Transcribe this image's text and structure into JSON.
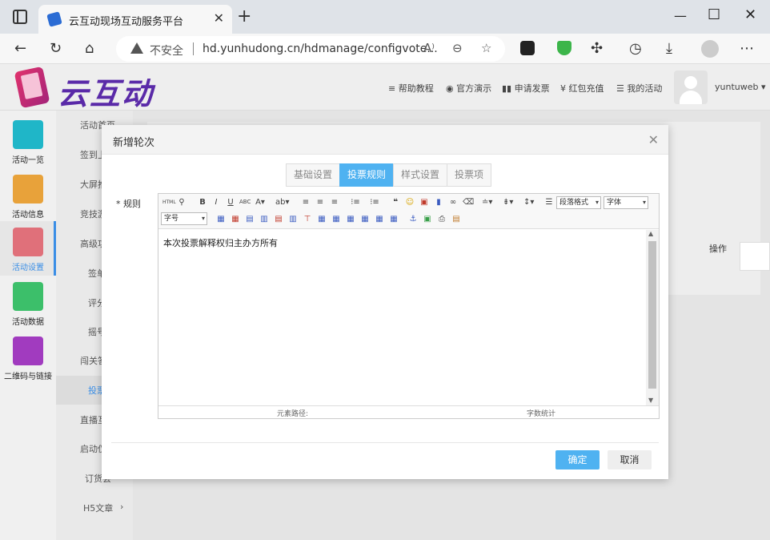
{
  "browser": {
    "tab_title": "云互动现场互动服务平台",
    "security_label": "不安全",
    "url": "hd.yunhudong.cn/hdmanage/configvote..."
  },
  "header": {
    "logo_text": "云互动",
    "links": [
      "帮助教程",
      "官方演示",
      "申请发票",
      "红包充值",
      "我的活动"
    ],
    "username": "yuntuweb"
  },
  "sidebar": {
    "items": [
      {
        "label": "活动一览",
        "color": "#1fb6c8"
      },
      {
        "label": "活动信息",
        "color": "#e8a23a"
      },
      {
        "label": "活动设置",
        "color": "#e0707a"
      },
      {
        "label": "活动数据",
        "color": "#3cbf6a"
      },
      {
        "label": "二维码与链接",
        "color": "#a13bbf"
      }
    ]
  },
  "subnav": {
    "items": [
      "活动首页",
      "签到上",
      "大屏推",
      "竞技游",
      "高级功",
      "签单",
      "评分",
      "摇号",
      "闯关答",
      "投票",
      "直播互",
      "启动仪",
      "订货会",
      "H5文章"
    ]
  },
  "modal": {
    "title": "新增轮次",
    "tabs": [
      "基础设置",
      "投票规则",
      "样式设置",
      "投票项"
    ],
    "active_tab": 1,
    "field_label": "* 规则",
    "editor_content": "本次投票解释权归主办方所有",
    "select_paragraph": "段落格式",
    "select_font": "字体",
    "select_size": "字号",
    "status_path": "元素路径:",
    "status_count": "字数统计",
    "ok_label": "确定",
    "cancel_label": "取消"
  },
  "content": {
    "table_header_action": "操作"
  }
}
